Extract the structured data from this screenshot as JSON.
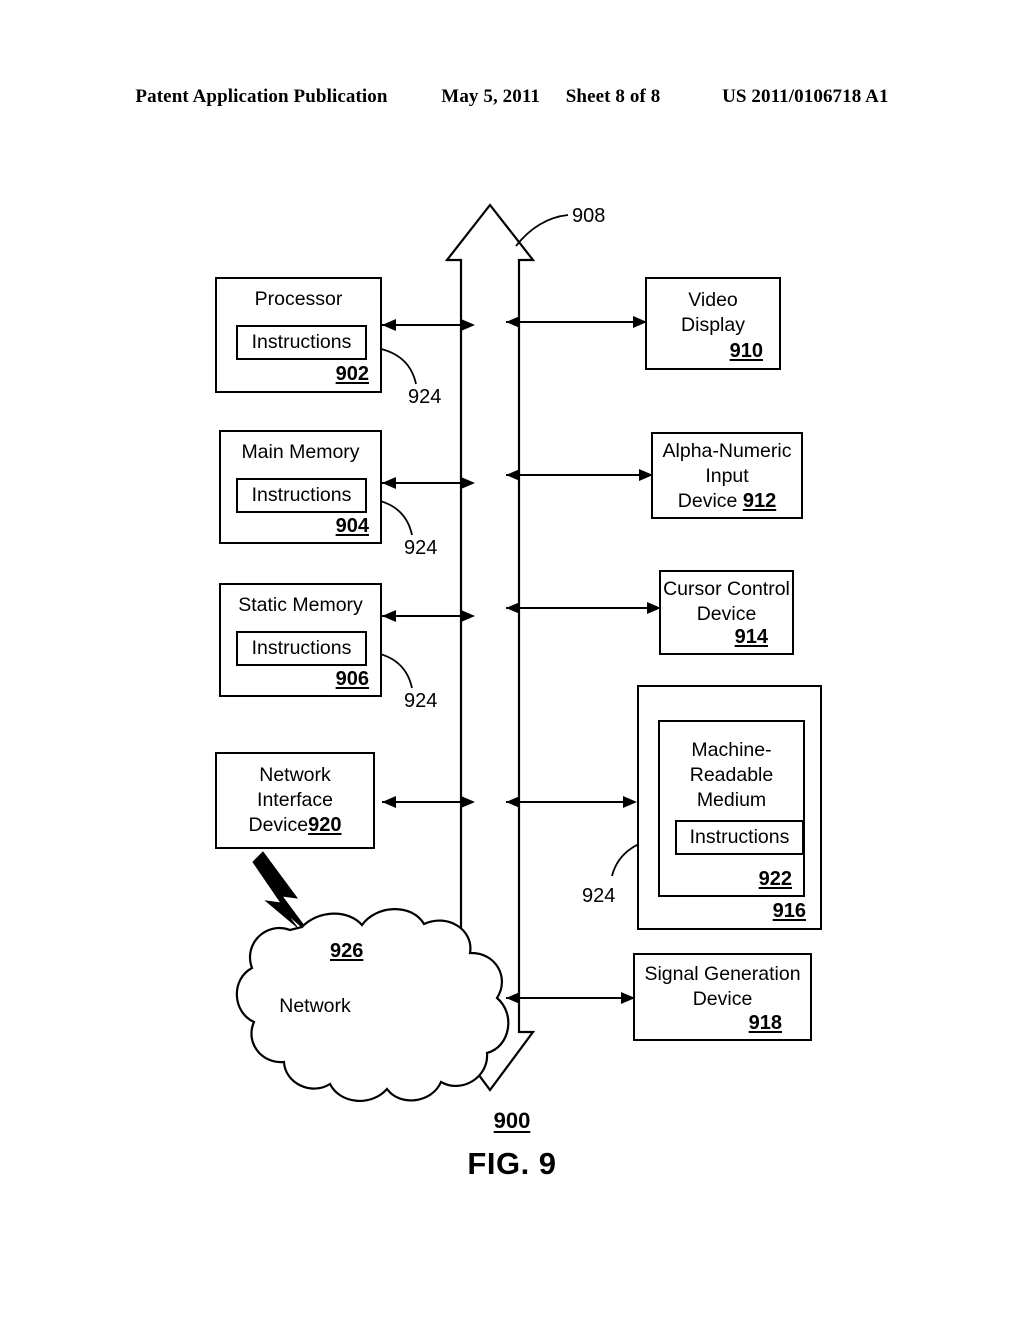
{
  "header": {
    "publication": "Patent Application Publication",
    "date": "May 5, 2011",
    "sheet": "Sheet 8 of 8",
    "patent_number": "US 2011/0106718 A1"
  },
  "figure": {
    "caption": "FIG. 9",
    "system_ref": "900",
    "bus_ref": "908"
  },
  "left_column": [
    {
      "name": "processor",
      "title": "Processor",
      "inner_label": "Instructions",
      "ref": "902",
      "leader_ref": "924"
    },
    {
      "name": "main-memory",
      "title": "Main Memory",
      "inner_label": "Instructions",
      "ref": "904",
      "leader_ref": "924"
    },
    {
      "name": "static-memory",
      "title": "Static Memory",
      "inner_label": "Instructions",
      "ref": "906",
      "leader_ref": "924"
    }
  ],
  "network_interface": {
    "title_line1": "Network",
    "title_line2": "Interface",
    "title_line3": "Device",
    "ref": "920"
  },
  "network_cloud": {
    "label": "Network",
    "ref": "926"
  },
  "right_column": [
    {
      "name": "video-display",
      "title_line1": "Video",
      "title_line2": "Display",
      "ref": "910"
    },
    {
      "name": "alpha-numeric-input-device",
      "title_line1": "Alpha-Numeric",
      "title_line2": "Input",
      "title_line3": "Device",
      "ref": "912"
    },
    {
      "name": "cursor-control-device",
      "title_line1": "Cursor Control",
      "title_line2": "Device",
      "ref": "914"
    },
    {
      "name": "signal-generation-device",
      "title_line1": "Signal Generation",
      "title_line2": "Device",
      "ref": "918"
    }
  ],
  "drive_unit": {
    "outer_ref": "916",
    "medium_line1": "Machine-",
    "medium_line2": "Readable",
    "medium_line3": "Medium",
    "medium_ref": "922",
    "inner_label": "Instructions",
    "leader_ref": "924"
  }
}
